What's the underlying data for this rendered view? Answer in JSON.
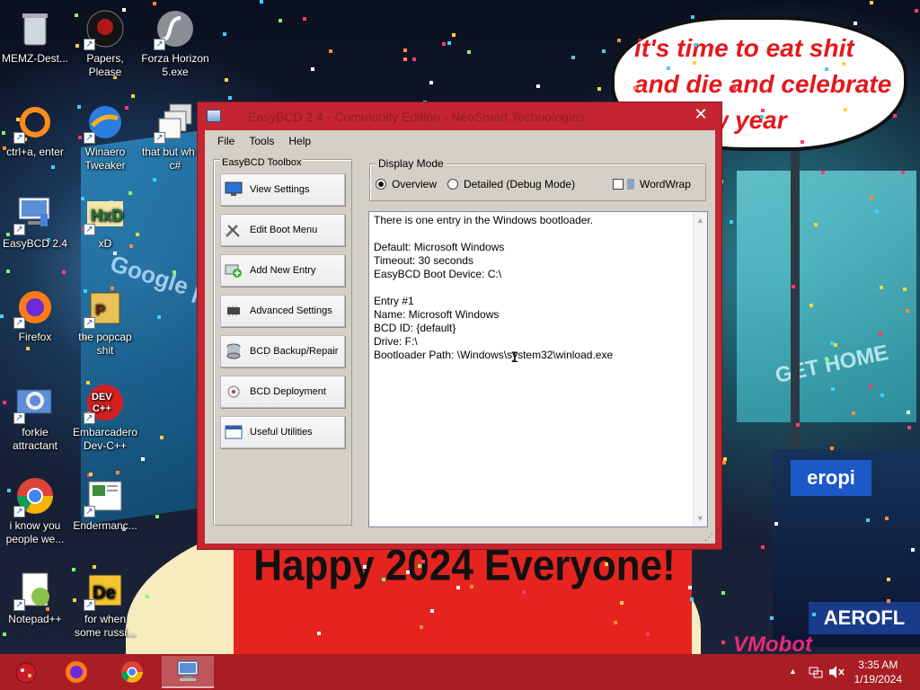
{
  "wallpaper": {
    "speech_bubble": "it's time to eat shit and die and celebrate the new year",
    "banner": "Happy 2024 Everyone!",
    "billboard_left": "Google play",
    "billboard_right": "GET HOME",
    "sign_1": "eropi",
    "sign_2": "AEROFL",
    "watermark": "VMobot"
  },
  "desktop_icons": [
    {
      "label": "MEMZ-Dest...",
      "icon": "recycle-bin-icon"
    },
    {
      "label": "Papers, Please",
      "icon": "papers-please-icon"
    },
    {
      "label": "Forza Horizon 5.exe",
      "icon": "flash-icon"
    },
    {
      "label": "ctrl+a, enter",
      "icon": "ring-icon"
    },
    {
      "label": "Winaero Tweaker",
      "icon": "winaero-icon"
    },
    {
      "label": "that but wh its c#",
      "icon": "stacked-windows-icon"
    },
    {
      "label": "EasyBCD 2.4",
      "icon": "computer-icon"
    },
    {
      "label": "xD",
      "icon": "hxd-icon"
    },
    {
      "label": "Firefox",
      "icon": "firefox-icon"
    },
    {
      "label": "the popcap shit",
      "icon": "popcap-icon"
    },
    {
      "label": "forkie attractant",
      "icon": "settings-computer-icon"
    },
    {
      "label": "Embarcadero Dev-C++",
      "icon": "devcpp-icon"
    },
    {
      "label": "i know you people we...",
      "icon": "chrome-icon"
    },
    {
      "label": "Endermanc...",
      "icon": "document-icon"
    },
    {
      "label": "Notepad++",
      "icon": "notepadpp-icon"
    },
    {
      "label": "for when some russi...",
      "icon": "de-icon"
    }
  ],
  "window": {
    "title": "EasyBCD 2.4 - Community Edition - NeoSmart Technologies",
    "close": "✕",
    "menu": [
      "File",
      "Tools",
      "Help"
    ],
    "toolbox_label": "EasyBCD Toolbox",
    "toolbox_buttons": [
      "View Settings",
      "Edit Boot Menu",
      "Add New Entry",
      "Advanced Settings",
      "BCD Backup/Repair",
      "BCD Deployment",
      "Useful Utilities"
    ],
    "display_mode_label": "Display Mode",
    "mode_overview": "Overview",
    "mode_detailed": "Detailed (Debug Mode)",
    "selected_mode": "Overview",
    "wordwrap_label": "WordWrap",
    "wordwrap_checked": false,
    "output_lines": [
      "There is one entry in the Windows bootloader.",
      "",
      "Default: Microsoft Windows",
      "Timeout: 30 seconds",
      "EasyBCD Boot Device: C:\\",
      "",
      "Entry #1",
      "Name: Microsoft Windows",
      "BCD ID: {default}",
      "Drive: F:\\",
      "Bootloader Path: \\Windows\\system32\\winload.exe"
    ]
  },
  "taskbar": {
    "apps": [
      "start-button",
      "firefox",
      "chrome",
      "easybcd"
    ],
    "active_app": "easybcd",
    "clock_time": "3:35 AM",
    "clock_date": "1/19/2024",
    "tray_caret": "▲"
  },
  "colors": {
    "window_frame": "#c42530",
    "taskbar": "#a81e24",
    "dialog_face": "#d4d0c8"
  }
}
